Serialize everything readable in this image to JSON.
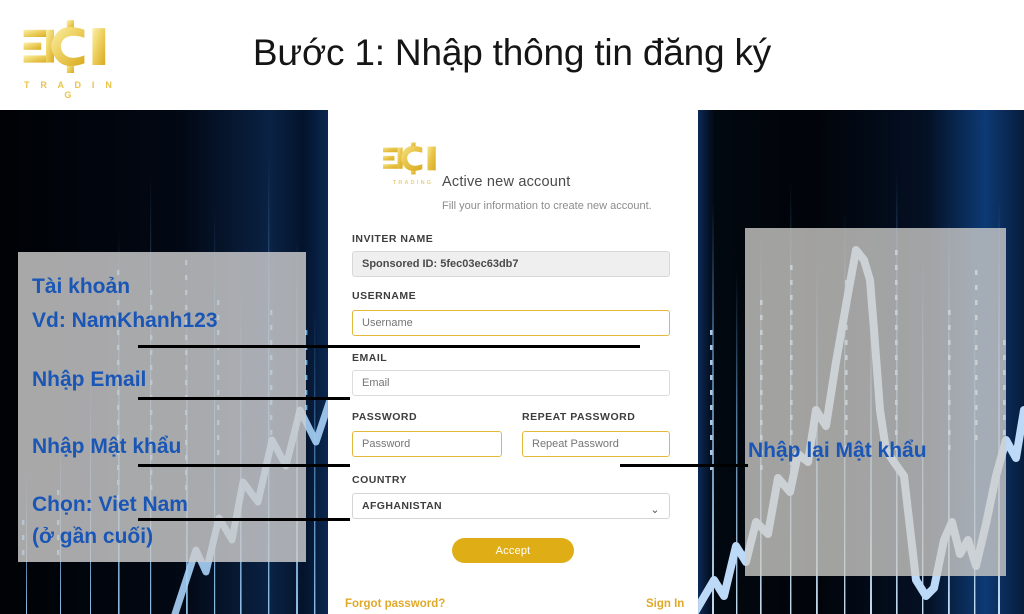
{
  "header": {
    "title": "Bước 1: Nhập thông tin đăng ký",
    "logo_word": "T R A D I N G",
    "logo_name": "fci-trading-logo"
  },
  "card": {
    "logo_word": "TRADING",
    "title": "Active new account",
    "subtitle": "Fill your information to create new account.",
    "fields": {
      "inviter_label": "INVITER NAME",
      "inviter_value": "Sponsored ID: 5fec03ec63db7",
      "username_label": "USERNAME",
      "username_placeholder": "Username",
      "username_value": "",
      "email_label": "EMAIL",
      "email_placeholder": "Email",
      "email_value": "",
      "password_label": "PASSWORD",
      "password_placeholder": "Password",
      "password_value": "",
      "repeat_password_label": "REPEAT PASSWORD",
      "repeat_password_placeholder": "Repeat Password",
      "repeat_password_value": "",
      "country_label": "COUNTRY",
      "country_selected": "AFGHANISTAN",
      "country_chevron": "⌄"
    },
    "accept_label": "Accept",
    "forgot_label": "Forgot password?",
    "signin_label": "Sign In"
  },
  "annotations": {
    "account_line1": "Tài khoản",
    "account_line2": "Vd: NamKhanh123",
    "email": "Nhập Email",
    "password": "Nhập Mật khẩu",
    "country_line1": "Chọn: Viet Nam",
    "country_line2": "(ở gần cuối)",
    "repeat_password": "Nhập lại Mật khẩu"
  },
  "colors": {
    "accent_gold": "#dfae17",
    "annotation_blue": "#1a56b5",
    "background_dark": "#010409",
    "chart_line": "#b9d8f7"
  }
}
